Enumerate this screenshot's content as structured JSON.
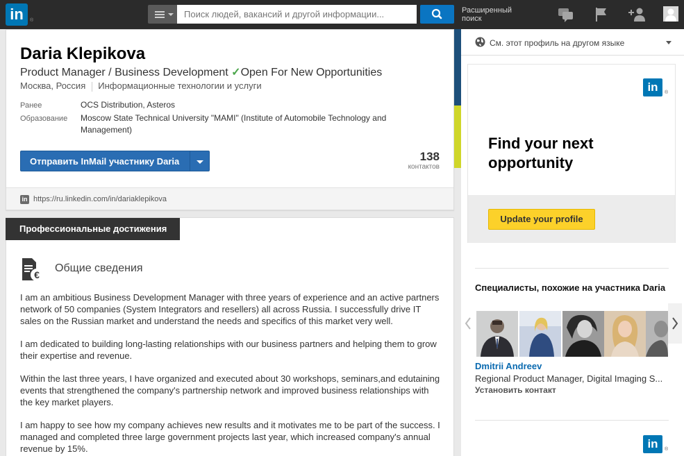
{
  "nav": {
    "logo_text": "in",
    "logo_reg": "®",
    "search_placeholder": "Поиск людей, вакансий и другой информации...",
    "advanced_search": "Расширенный поиск",
    "icons": [
      "menu-icon",
      "search-icon",
      "messages-icon",
      "flag-icon",
      "add-connection-icon",
      "profile-avatar-icon"
    ]
  },
  "profile": {
    "name": "Daria Klepikova",
    "headline": "Product Manager / Business Development",
    "check": "✓",
    "headline_status": "Open For New Opportunities",
    "location": "Москва, Россия",
    "industry": "Информационные технологии и услуги",
    "previous_label": "Ранее",
    "previous_value": "OCS Distribution, Asteros",
    "education_label": "Образование",
    "education_value": "Moscow State Technical University \"MAMI\" (Institute of Automobile Technology and Management)",
    "inmail_button": "Отправить InMail участнику Daria",
    "connections_count": "138",
    "connections_label": "контактов",
    "public_url": "https://ru.linkedin.com/in/dariaklepikova",
    "url_icon_text": "in"
  },
  "summary": {
    "section_tab": "Профессиональные достижения",
    "title": "Общие сведения",
    "paragraphs": [
      "I am an ambitious Business Development Manager with three years of experience and an active partners network of 50 companies (System Integrators and resellers) all across Russia. I successfully drive IT sales on the Russian market and understand the needs and specifics of this market very well.",
      "I am dedicated to building long-lasting relationships with our business partners and helping them to grow their expertise and revenue.",
      "Within the last three years, I have organized and executed about 30 workshops, seminars,and edutaining events that strengthened the company's partnership network and improved business relationships with the key market players.",
      "I am happy to see how my company achieves new results and it motivates me to be part of the success. I managed and completed three large government projects last year, which increased company's annual revenue by 15%."
    ]
  },
  "rail": {
    "language_text": "См. этот профиль на другом языке",
    "ad_logo": "in",
    "ad_reg": "®",
    "ad_headline": "Find your next opportunity",
    "ad_button": "Update your profile",
    "pymk_title": "Специалисты, похожие на участника Daria",
    "pymk_name": "Dmitrii Andreev",
    "pymk_role": "Regional Product Manager, Digital Imaging S...",
    "pymk_connect": "Установить контакт"
  },
  "colors": {
    "linkedin_blue": "#0077b5",
    "button_blue": "#2a6db3",
    "ad_button_yellow": "#fcd12a",
    "link_blue": "#0a6ab0",
    "check_green": "#4ca64c"
  }
}
